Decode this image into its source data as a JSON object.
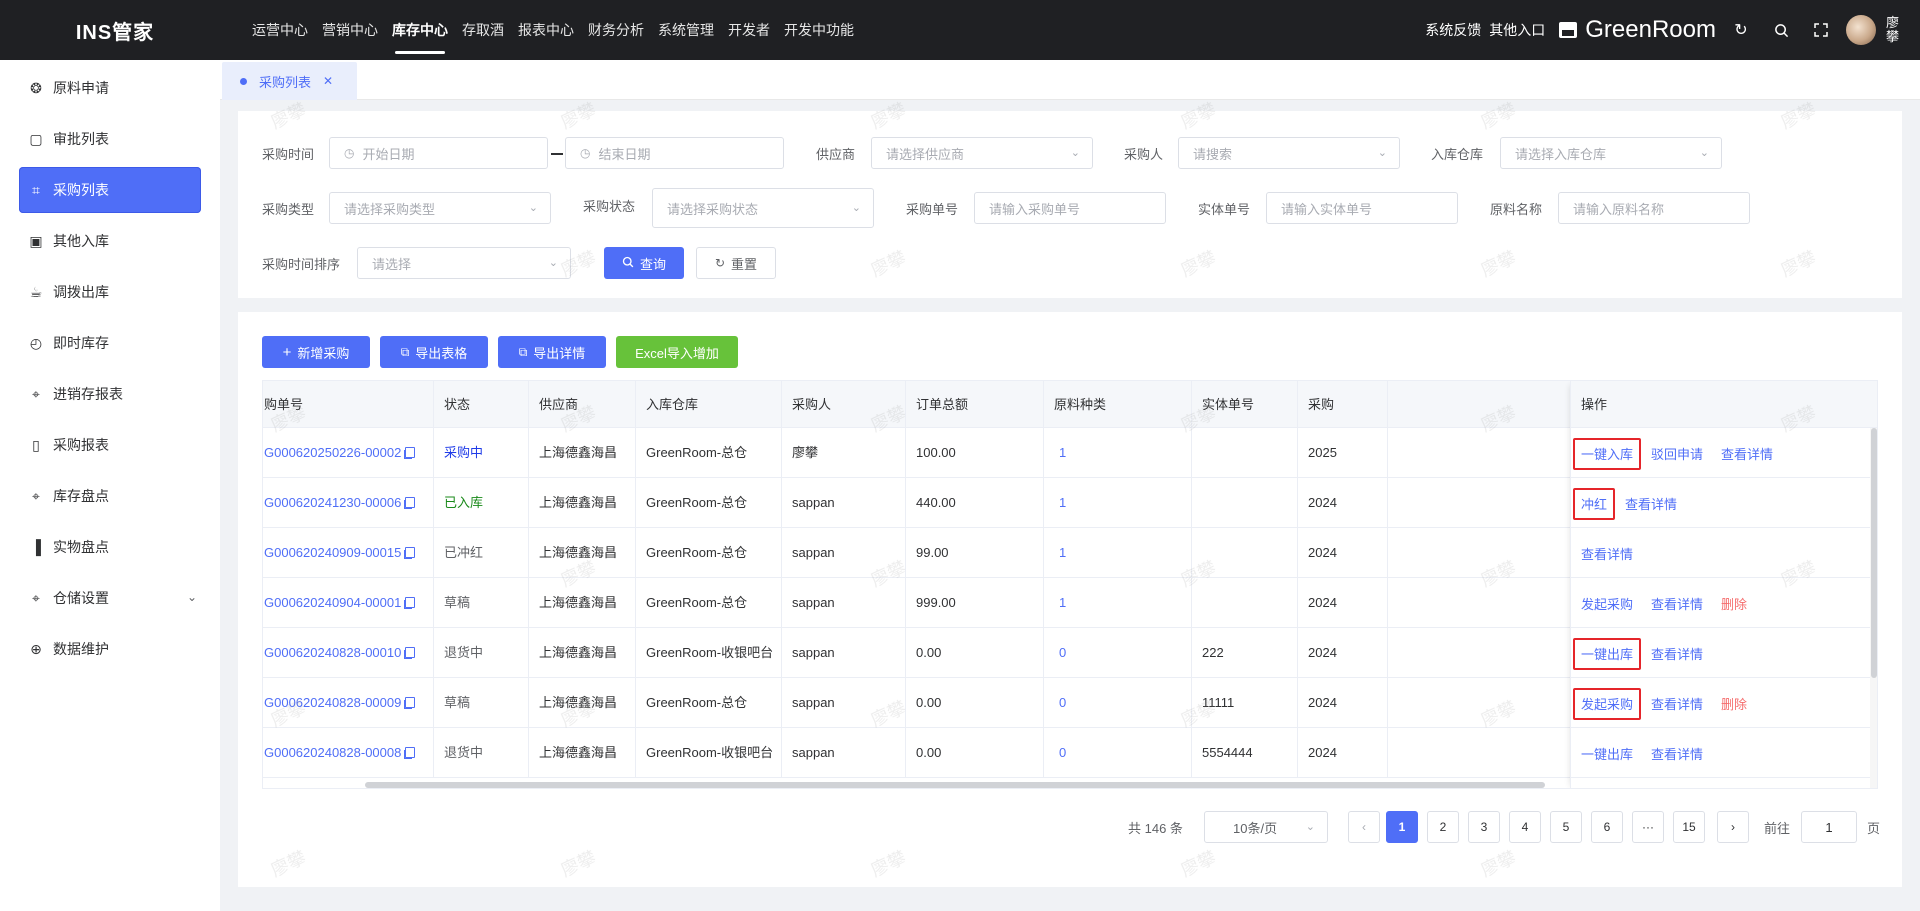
{
  "app": {
    "logo": "INS管家",
    "brand": "GreenRoom",
    "user": "廖攀"
  },
  "topnav": [
    {
      "label": "运营中心",
      "active": false
    },
    {
      "label": "营销中心",
      "active": false
    },
    {
      "label": "库存中心",
      "active": true
    },
    {
      "label": "存取酒",
      "active": false
    },
    {
      "label": "报表中心",
      "active": false
    },
    {
      "label": "财务分析",
      "active": false
    },
    {
      "label": "系统管理",
      "active": false
    },
    {
      "label": "开发者",
      "active": false
    },
    {
      "label": "开发中功能",
      "active": false
    }
  ],
  "topright": {
    "feedback": "系统反馈",
    "other": "其他入口"
  },
  "sidebar": {
    "items": [
      {
        "label": "原料申请",
        "icon": "palette-icon"
      },
      {
        "label": "审批列表",
        "icon": "chat-icon"
      },
      {
        "label": "采购列表",
        "icon": "crop-icon",
        "active": true
      },
      {
        "label": "其他入库",
        "icon": "briefcase-icon"
      },
      {
        "label": "调拨出库",
        "icon": "cup-icon"
      },
      {
        "label": "即时库存",
        "icon": "timer-icon"
      },
      {
        "label": "进销存报表",
        "icon": "target-icon"
      },
      {
        "label": "采购报表",
        "icon": "phone-icon"
      },
      {
        "label": "库存盘点",
        "icon": "target-icon"
      },
      {
        "label": "实物盘点",
        "icon": "bar-chart-icon"
      },
      {
        "label": "仓储设置",
        "icon": "target-icon",
        "expandable": true
      },
      {
        "label": "数据维护",
        "icon": "plus-circle-icon"
      }
    ]
  },
  "tabs": [
    {
      "label": "采购列表"
    }
  ],
  "filters": {
    "time_label": "采购时间",
    "start_ph": "开始日期",
    "end_ph": "结束日期",
    "supplier_label": "供应商",
    "supplier_ph": "请选择供应商",
    "buyer_label": "采购人",
    "buyer_ph": "请搜索",
    "warehouse_label": "入库仓库",
    "warehouse_ph": "请选择入库仓库",
    "type_label": "采购类型",
    "type_ph": "请选择采购类型",
    "status_label": "采购状态",
    "status_ph": "请选择采购状态",
    "order_label": "采购单号",
    "order_ph": "请输入采购单号",
    "entity_label": "实体单号",
    "entity_ph": "请输入实体单号",
    "material_label": "原料名称",
    "material_ph": "请输入原料名称",
    "sort_label": "采购时间排序",
    "sort_ph": "请选择",
    "query_btn": "查询",
    "reset_btn": "重置"
  },
  "actions": {
    "add": "新增采购",
    "export_table": "导出表格",
    "export_detail": "导出详情",
    "excel_import": "Excel导入增加"
  },
  "table": {
    "headers": [
      "购单号",
      "状态",
      "供应商",
      "入库仓库",
      "采购人",
      "订单总额",
      "原料种类",
      "实体单号",
      "采购",
      "操作"
    ],
    "rows": [
      {
        "no": "G000620250226-00002",
        "status": "采购中",
        "status_type": "blue",
        "supplier": "上海德鑫海昌",
        "warehouse": "GreenRoom-总仓",
        "buyer": "廖攀",
        "amount": "100.00",
        "kinds": "1",
        "entity": "",
        "time": "2025",
        "ops": [
          "一键入库",
          "驳回申请",
          "查看详情"
        ],
        "hl": 0
      },
      {
        "no": "G000620241230-00006",
        "status": "已入库",
        "status_type": "green",
        "supplier": "上海德鑫海昌",
        "warehouse": "GreenRoom-总仓",
        "buyer": "sappan",
        "amount": "440.00",
        "kinds": "1",
        "entity": "",
        "time": "2024",
        "ops": [
          "冲红",
          "查看详情"
        ],
        "hl": 0
      },
      {
        "no": "G000620240909-00015",
        "status": "已冲红",
        "status_type": "gray",
        "supplier": "上海德鑫海昌",
        "warehouse": "GreenRoom-总仓",
        "buyer": "sappan",
        "amount": "99.00",
        "kinds": "1",
        "entity": "",
        "time": "2024",
        "ops": [
          "查看详情"
        ],
        "hl": -1
      },
      {
        "no": "G000620240904-00001",
        "status": "草稿",
        "status_type": "gray",
        "supplier": "上海德鑫海昌",
        "warehouse": "GreenRoom-总仓",
        "buyer": "sappan",
        "amount": "999.00",
        "kinds": "1",
        "entity": "",
        "time": "2024",
        "ops": [
          "发起采购",
          "查看详情",
          "删除"
        ],
        "hl": -1
      },
      {
        "no": "G000620240828-00010",
        "status": "退货中",
        "status_type": "gray",
        "supplier": "上海德鑫海昌",
        "warehouse": "GreenRoom-收银吧台",
        "buyer": "sappan",
        "amount": "0.00",
        "kinds": "0",
        "entity": "222",
        "time": "2024",
        "ops": [
          "一键出库",
          "查看详情"
        ],
        "hl": 0
      },
      {
        "no": "G000620240828-00009",
        "status": "草稿",
        "status_type": "gray",
        "supplier": "上海德鑫海昌",
        "warehouse": "GreenRoom-总仓",
        "buyer": "sappan",
        "amount": "0.00",
        "kinds": "0",
        "entity": "11111",
        "time": "2024",
        "ops": [
          "发起采购",
          "查看详情",
          "删除"
        ],
        "hl": 0
      },
      {
        "no": "G000620240828-00008",
        "status": "退货中",
        "status_type": "gray",
        "supplier": "上海德鑫海昌",
        "warehouse": "GreenRoom-收银吧台",
        "buyer": "sappan",
        "amount": "0.00",
        "kinds": "0",
        "entity": "5554444",
        "time": "2024",
        "ops": [
          "一键出库",
          "查看详情"
        ],
        "hl": -1
      }
    ]
  },
  "pagination": {
    "total": "共 146 条",
    "page_size": "10条/页",
    "pages": [
      "1",
      "2",
      "3",
      "4",
      "5",
      "6",
      "···",
      "15"
    ],
    "current": "1",
    "goto_prefix": "前往",
    "goto_value": "1",
    "goto_suffix": "页"
  },
  "watermark": "廖攀",
  "colors": {
    "primary": "#4f6ef7",
    "success": "#67c23a",
    "danger": "#f56c6c",
    "highlight": "#e5252a",
    "topbar": "#1f2023"
  }
}
